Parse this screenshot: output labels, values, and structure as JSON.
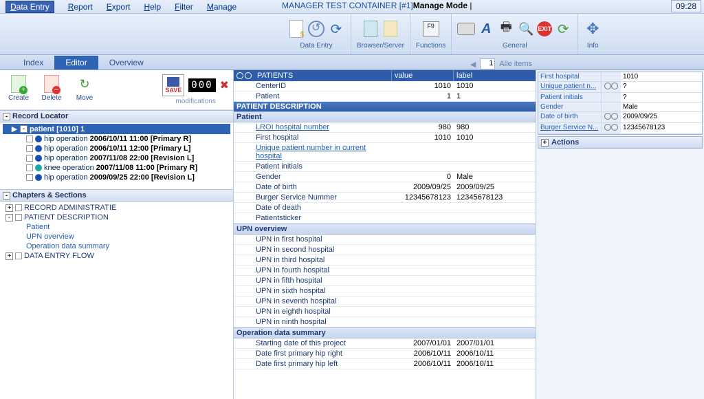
{
  "menu": {
    "items": [
      "Data Entry",
      "Report",
      "Export",
      "Help",
      "Filter",
      "Manage"
    ],
    "activeIndex": 0,
    "title": "MANAGER TEST CONTAINER [#1]",
    "mode": "Manage Mode",
    "clock": "09:28"
  },
  "ribbon": {
    "groups": [
      {
        "label": "Data Entry"
      },
      {
        "label": "Browser/Server"
      },
      {
        "label": "Functions",
        "key": "F9"
      },
      {
        "label": "General",
        "exit": "EXIT"
      },
      {
        "label": "Info"
      }
    ]
  },
  "tabs": {
    "items": [
      "Index",
      "Editor",
      "Overview"
    ],
    "activeIndex": 1,
    "page": "1",
    "pageLabel": "Alle items"
  },
  "left": {
    "buttons": {
      "create": "Create",
      "delete": "Delete",
      "move": "Move"
    },
    "save": "SAVE",
    "counter": "000",
    "modifications": "modifications",
    "recordLocator": {
      "title": "Record Locator",
      "patient": "patient  [1010] 1",
      "items": [
        {
          "dot": "blue",
          "label": "hip operation",
          "ts": "2006/10/11 11:00 [Primary R]"
        },
        {
          "dot": "blue",
          "label": "hip operation",
          "ts": "2006/10/11 12:00 [Primary L]"
        },
        {
          "dot": "blue",
          "label": "hip operation",
          "ts": "2007/11/08 22:00 [Revision L]"
        },
        {
          "dot": "teal",
          "label": "knee operation",
          "ts": "2007/11/08 11:00 [Primary R]"
        },
        {
          "dot": "blue",
          "label": "hip operation",
          "ts": "2009/09/25 22:00 [Revision L]"
        }
      ]
    },
    "chapters": {
      "title": "Chapters & Sections",
      "items": [
        {
          "exp": "+",
          "label": "RECORD ADMINISTRATIE"
        },
        {
          "exp": "-",
          "label": "PATIENT DESCRIPTION",
          "children": [
            "Patient",
            "UPN overview",
            "Operation data summary"
          ]
        },
        {
          "exp": "+",
          "label": "DATA ENTRY FLOW"
        }
      ]
    }
  },
  "mid": {
    "header": {
      "lead": "⊙⊙",
      "title": "PATIENTS",
      "col2": "value",
      "col3": "label"
    },
    "rows": [
      {
        "t": "row",
        "c1": "CenterID",
        "c2": "1010",
        "c3": "1010"
      },
      {
        "t": "row",
        "c1": "Patient",
        "c2": "1",
        "c3": "1"
      },
      {
        "t": "grp",
        "label": "PATIENT DESCRIPTION"
      },
      {
        "t": "sub",
        "label": "Patient"
      },
      {
        "t": "row",
        "c1": "LROI hospital number",
        "link": true,
        "c2": "980",
        "c3": "980"
      },
      {
        "t": "row",
        "c1": "First hospital",
        "c2": "1010",
        "c3": "1010"
      },
      {
        "t": "row",
        "c1": "Unique patient number in current hospital",
        "link": true,
        "c2": "",
        "c3": ""
      },
      {
        "t": "row",
        "c1": "Patient initials",
        "c2": "",
        "c3": ""
      },
      {
        "t": "row",
        "c1": "Gender",
        "c2": "0",
        "c3": "Male"
      },
      {
        "t": "row",
        "c1": "Date of birth",
        "c2": "2009/09/25",
        "c3": "2009/09/25"
      },
      {
        "t": "row",
        "c1": "Burger Service Nummer",
        "c2": "12345678123",
        "c3": "12345678123"
      },
      {
        "t": "row",
        "c1": "Date of death",
        "c2": "",
        "c3": ""
      },
      {
        "t": "row",
        "c1": "Patientsticker",
        "c2": "",
        "c3": ""
      },
      {
        "t": "sub",
        "label": "UPN overview"
      },
      {
        "t": "row",
        "c1": "UPN in first hospital",
        "c2": "",
        "c3": ""
      },
      {
        "t": "row",
        "c1": "UPN in second hospital",
        "c2": "",
        "c3": ""
      },
      {
        "t": "row",
        "c1": "UPN in third hospital",
        "c2": "",
        "c3": ""
      },
      {
        "t": "row",
        "c1": "UPN in fourth hospital",
        "c2": "",
        "c3": ""
      },
      {
        "t": "row",
        "c1": "UPN in fifth hospital",
        "c2": "",
        "c3": ""
      },
      {
        "t": "row",
        "c1": "UPN in sixth hospital",
        "c2": "",
        "c3": ""
      },
      {
        "t": "row",
        "c1": "UPN in seventh hospital",
        "c2": "",
        "c3": ""
      },
      {
        "t": "row",
        "c1": "UPN in eighth hospital",
        "c2": "",
        "c3": ""
      },
      {
        "t": "row",
        "c1": "UPN in ninth hospital",
        "c2": "",
        "c3": ""
      },
      {
        "t": "sub",
        "label": "Operation data summary"
      },
      {
        "t": "row",
        "c1": "Starting date of this project",
        "c2": "2007/01/01",
        "c3": "2007/01/01"
      },
      {
        "t": "row",
        "c1": "Date first primary hip right",
        "c2": "2006/10/11",
        "c3": "2006/10/11"
      },
      {
        "t": "row",
        "c1": "Date first primary hip left",
        "c2": "2006/10/11",
        "c3": "2006/10/11"
      }
    ]
  },
  "right": {
    "props": [
      {
        "label": "First hospital",
        "u": false,
        "icons": "",
        "val": "1010"
      },
      {
        "label": "Unique patient n...",
        "u": true,
        "icons": "⊙⊙",
        "val": "?"
      },
      {
        "label": "Patient initials",
        "u": false,
        "icons": "",
        "val": "?"
      },
      {
        "label": "Gender",
        "u": false,
        "icons": "",
        "val": "Male"
      },
      {
        "label": "Date of birth",
        "u": false,
        "icons": "⊙⊙",
        "val": "2009/09/25"
      },
      {
        "label": "Burger Service N...",
        "u": true,
        "icons": "⊙⊙",
        "val": "12345678123"
      }
    ],
    "actions": "Actions"
  }
}
